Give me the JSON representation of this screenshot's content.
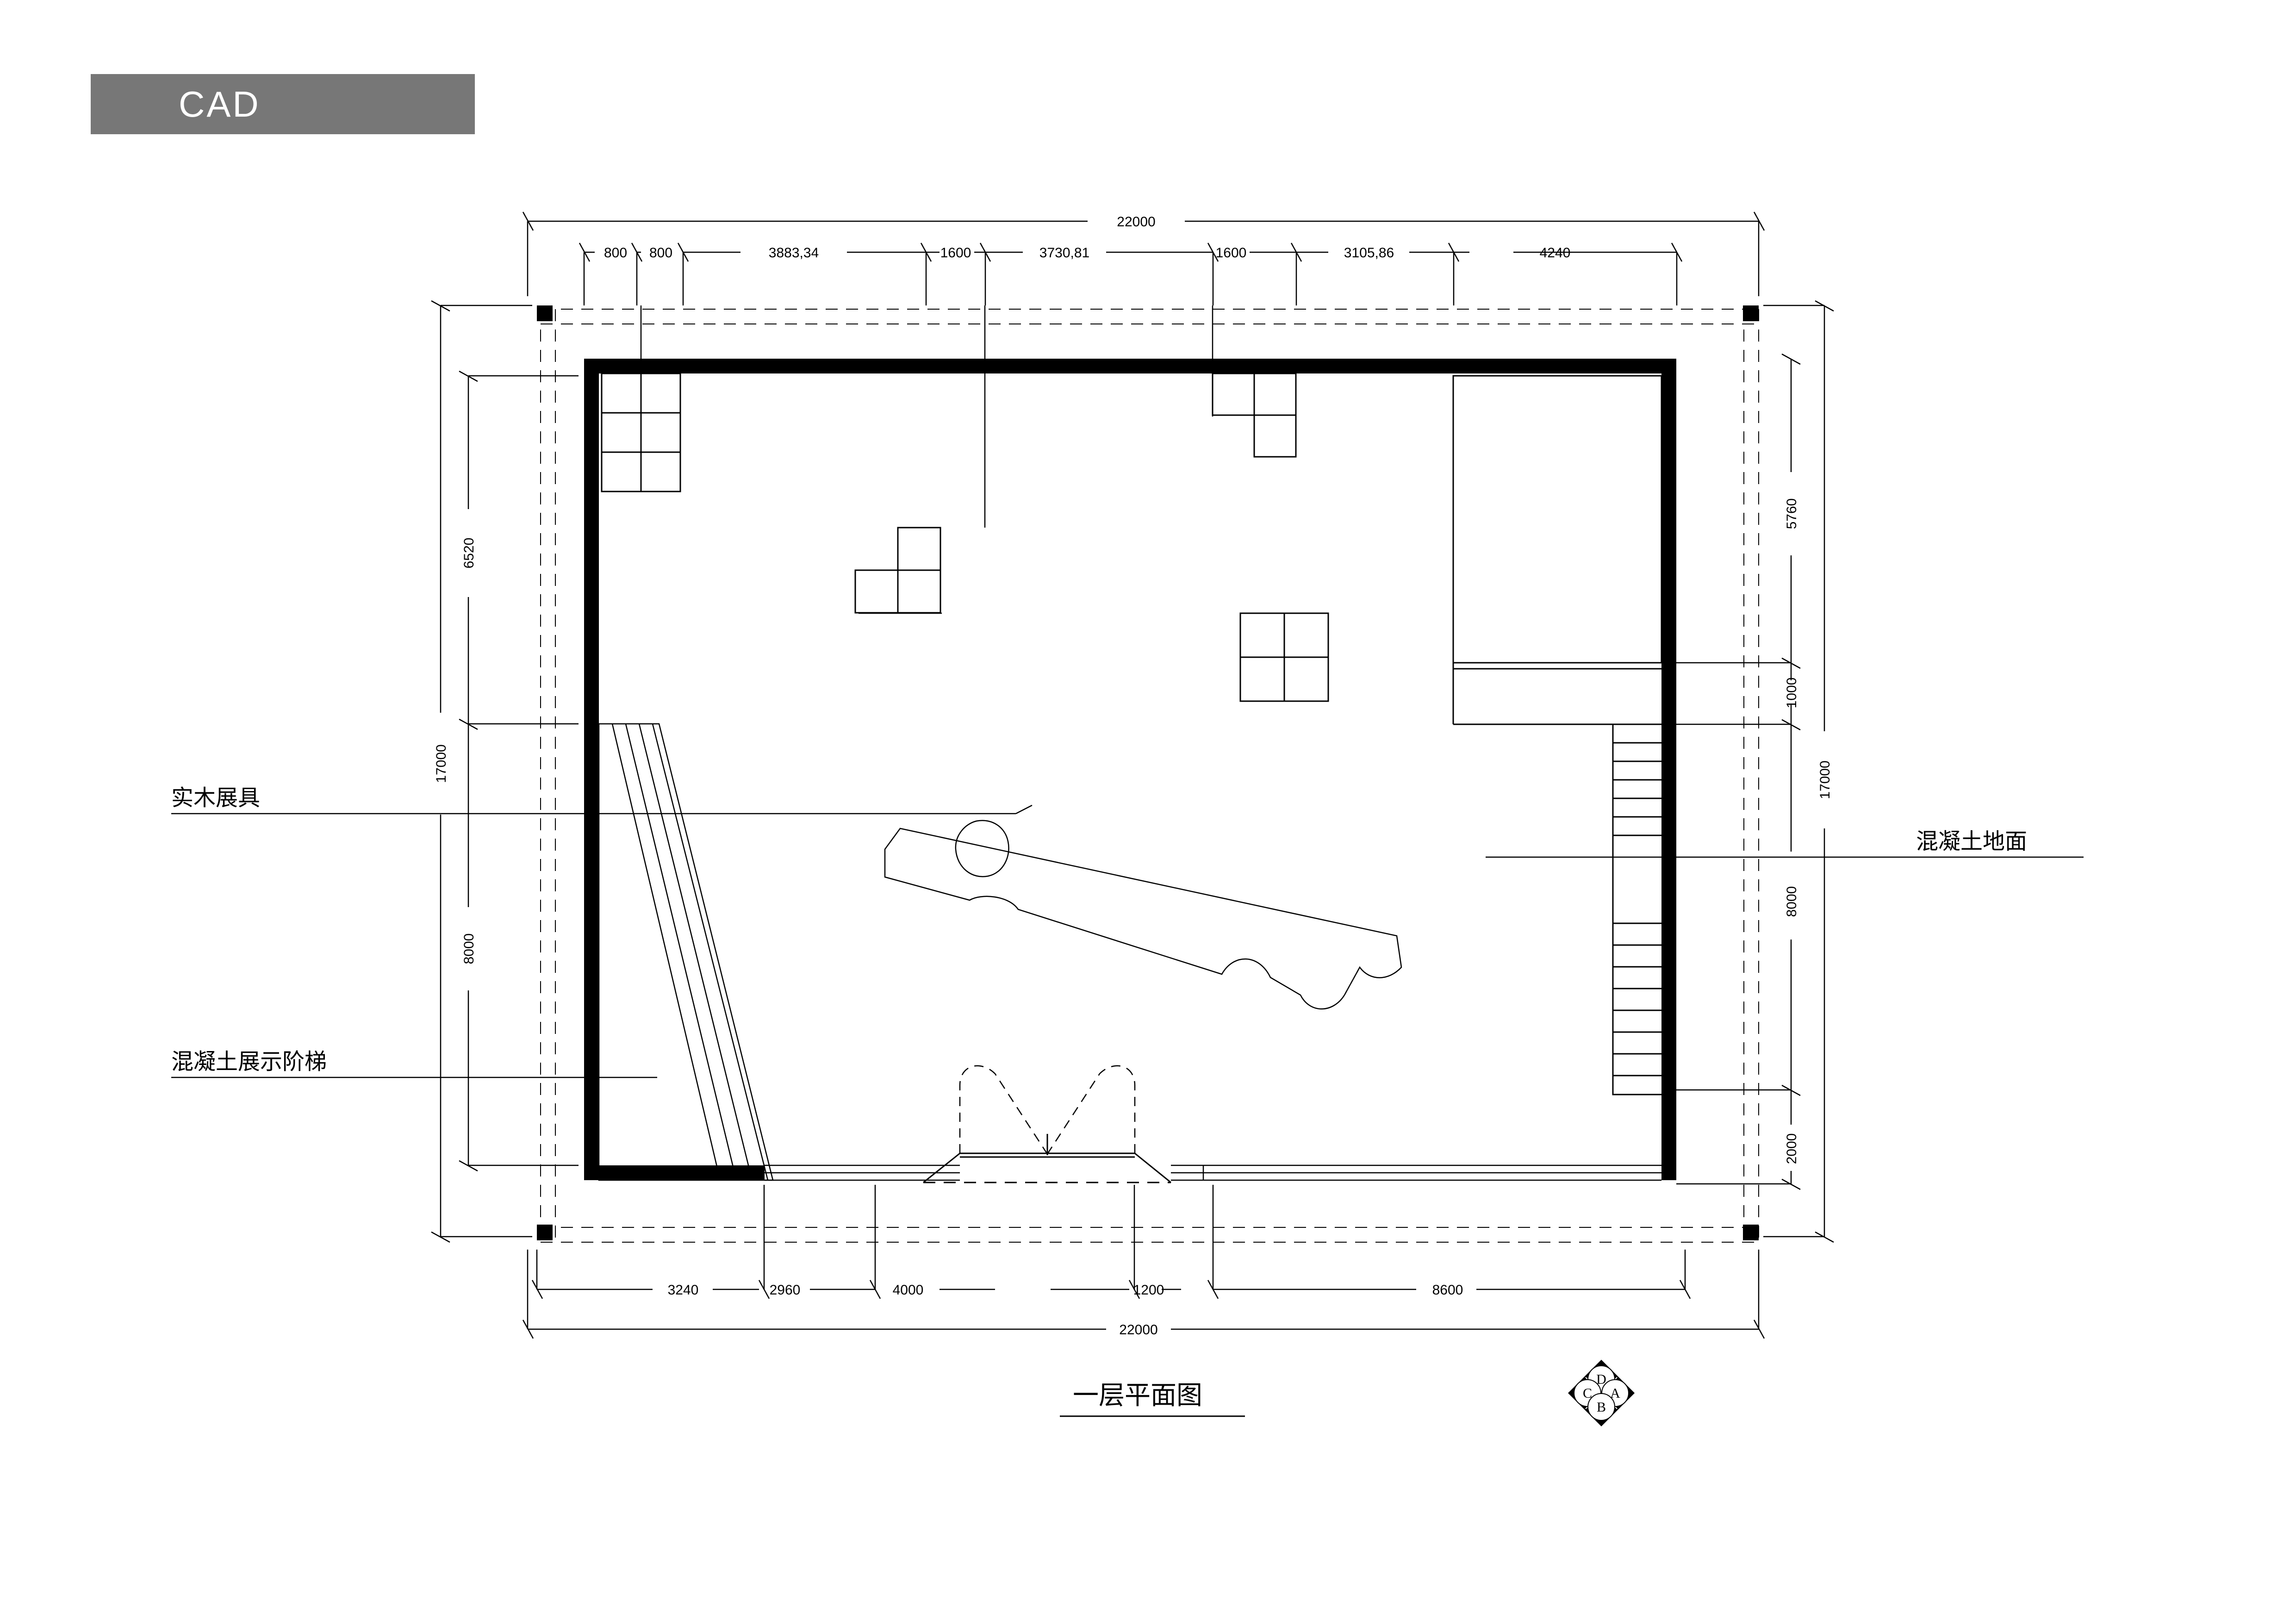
{
  "header": {
    "banner_label": "CAD",
    "banner_color": "#777777",
    "banner_text_color": "#ffffff"
  },
  "drawing": {
    "title": "一层平面图",
    "sheet_background": "#ffffff",
    "line_color": "#000000",
    "wall_fill": "#000000"
  },
  "annotations": [
    {
      "name": "solid-wood-display-fixture",
      "label": "实木展具",
      "side": "left"
    },
    {
      "name": "concrete-display-stairs",
      "label": "混凝土展示阶梯",
      "side": "left"
    },
    {
      "name": "concrete-floor",
      "label": "混凝土地面",
      "side": "right"
    }
  ],
  "dimensions": {
    "top_overall": "22000",
    "top_chain": [
      "800",
      "800",
      "3883,34",
      "1600",
      "3730,81",
      "1600",
      "3105,86",
      "4240"
    ],
    "bottom_overall": "22000",
    "bottom_chain": [
      "3240",
      "2960",
      "4000",
      "1200",
      "8600"
    ],
    "left_overall": "17000",
    "left_chain": [
      "6520",
      "8000"
    ],
    "right_overall": "17000",
    "right_chain": [
      "5760",
      "1000",
      "8000",
      "2000"
    ]
  },
  "compass": {
    "name": "orientation-symbol",
    "top": "D",
    "left": "C",
    "right": "A",
    "bottom": "B"
  }
}
